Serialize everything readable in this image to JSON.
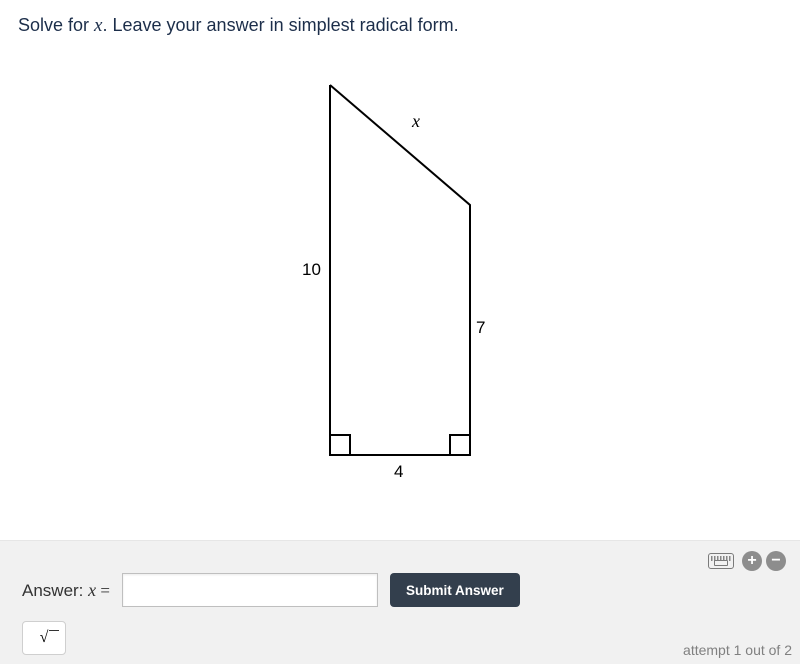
{
  "prompt": {
    "pre": "Solve for ",
    "var": "x",
    "post": ". Leave your answer in simplest radical form."
  },
  "figure": {
    "labels": {
      "x": "x",
      "left": "10",
      "right": "7",
      "bottom": "4"
    }
  },
  "answer": {
    "label_prefix": "Answer: ",
    "var": "x",
    "equals": " =",
    "value": "",
    "placeholder": "",
    "submit": "Submit Answer",
    "sqrt": "√"
  },
  "attempt": {
    "text": "attempt 1 out of 2"
  },
  "tools": {
    "plus": "+",
    "minus": "−"
  }
}
